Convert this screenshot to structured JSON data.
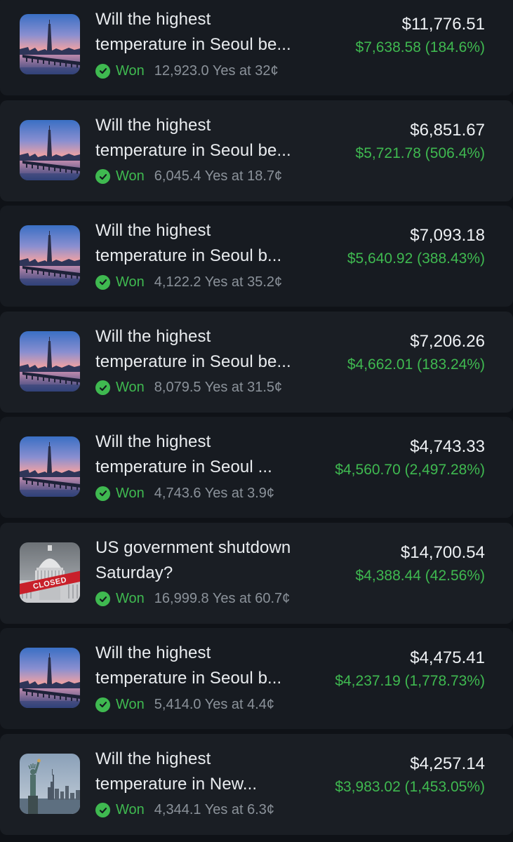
{
  "colors": {
    "background": "#0f1217",
    "card": "#171b21",
    "won_green": "#3fb950",
    "muted_text": "#8b929a"
  },
  "positions": [
    {
      "image": "seoul-skyline",
      "title_line1": "Will the highest",
      "title_line2": "temperature in Seoul be...",
      "status": "Won",
      "shares_text": "12,923.0 Yes at 32¢",
      "value": "$11,776.51",
      "pnl": "$7,638.58 (184.6%)"
    },
    {
      "image": "seoul-skyline",
      "title_line1": "Will the highest",
      "title_line2": "temperature in Seoul be...",
      "status": "Won",
      "shares_text": "6,045.4 Yes at 18.7¢",
      "value": "$6,851.67",
      "pnl": "$5,721.78 (506.4%)"
    },
    {
      "image": "seoul-skyline",
      "title_line1": "Will the highest",
      "title_line2": "temperature in Seoul b...",
      "status": "Won",
      "shares_text": "4,122.2 Yes at 35.2¢",
      "value": "$7,093.18",
      "pnl": "$5,640.92 (388.43%)"
    },
    {
      "image": "seoul-skyline",
      "title_line1": "Will the highest",
      "title_line2": "temperature in Seoul be...",
      "status": "Won",
      "shares_text": "8,079.5 Yes at 31.5¢",
      "value": "$7,206.26",
      "pnl": "$4,662.01 (183.24%)"
    },
    {
      "image": "seoul-skyline",
      "title_line1": "Will the highest",
      "title_line2": "temperature in Seoul ...",
      "status": "Won",
      "shares_text": "4,743.6 Yes at 3.9¢",
      "value": "$4,743.33",
      "pnl": "$4,560.70 (2,497.28%)"
    },
    {
      "image": "us-capitol-closed",
      "stamp": "CLOSED",
      "title_line1": "US government shutdown",
      "title_line2": "Saturday?",
      "status": "Won",
      "shares_text": "16,999.8 Yes at 60.7¢",
      "value": "$14,700.54",
      "pnl": "$4,388.44 (42.56%)"
    },
    {
      "image": "seoul-skyline",
      "title_line1": "Will the highest",
      "title_line2": "temperature in Seoul b...",
      "status": "Won",
      "shares_text": "5,414.0 Yes at 4.4¢",
      "value": "$4,475.41",
      "pnl": "$4,237.19 (1,778.73%)"
    },
    {
      "image": "new-york-statue-of-liberty",
      "title_line1": "Will the highest",
      "title_line2": "temperature in New...",
      "status": "Won",
      "shares_text": "4,344.1 Yes at 6.3¢",
      "value": "$4,257.14",
      "pnl": "$3,983.02 (1,453.05%)"
    }
  ]
}
